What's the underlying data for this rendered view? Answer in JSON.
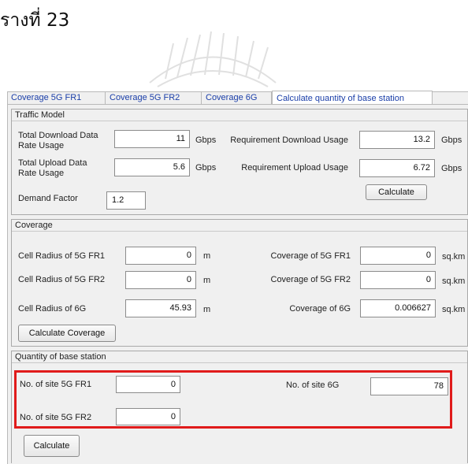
{
  "heading": "รางที่ 23",
  "tabs": [
    {
      "label": "Coverage 5G FR1"
    },
    {
      "label": "Coverage 5G FR2"
    },
    {
      "label": "Coverage 6G"
    },
    {
      "label": "Calculate quantity of base station",
      "active": true
    }
  ],
  "traffic": {
    "title": "Traffic Model",
    "total_download_label": "Total Download Data Rate Usage",
    "total_download_value": "11",
    "total_download_unit": "Gbps",
    "req_download_label": "Requirement Download Usage",
    "req_download_value": "13.2",
    "req_download_unit": "Gbps",
    "total_upload_label": "Total Upload Data Rate Usage",
    "total_upload_value": "5.6",
    "total_upload_unit": "Gbps",
    "req_upload_label": "Requirement Upload Usage",
    "req_upload_value": "6.72",
    "req_upload_unit": "Gbps",
    "demand_label": "Demand Factor",
    "demand_value": "1.2",
    "calculate_label": "Calculate"
  },
  "coverage": {
    "title": "Coverage",
    "radius_fr1_label": "Cell Radius of 5G FR1",
    "radius_fr1_value": "0",
    "radius_fr2_label": "Cell Radius of 5G FR2",
    "radius_fr2_value": "0",
    "radius_6g_label": "Cell Radius of 6G",
    "radius_6g_value": "45.93",
    "radius_unit": "m",
    "cov_fr1_label": "Coverage of 5G FR1",
    "cov_fr1_value": "0",
    "cov_fr2_label": "Coverage of 5G FR2",
    "cov_fr2_value": "0",
    "cov_6g_label": "Coverage of 6G",
    "cov_6g_value": "0.006627",
    "cov_unit": "sq.km",
    "calculate_label": "Calculate Coverage"
  },
  "quantity": {
    "title": "Quantity of base station",
    "site_fr1_label": "No. of site 5G FR1",
    "site_fr1_value": "0",
    "site_fr2_label": "No. of site 5G FR2",
    "site_fr2_value": "0",
    "site_6g_label": "No. of site 6G",
    "site_6g_value": "78",
    "calculate_label": "Calculate"
  },
  "colors": {
    "highlight": "#e01b1b",
    "tab_text": "#1a3ea8",
    "panel_bg": "#f0f0f0"
  }
}
